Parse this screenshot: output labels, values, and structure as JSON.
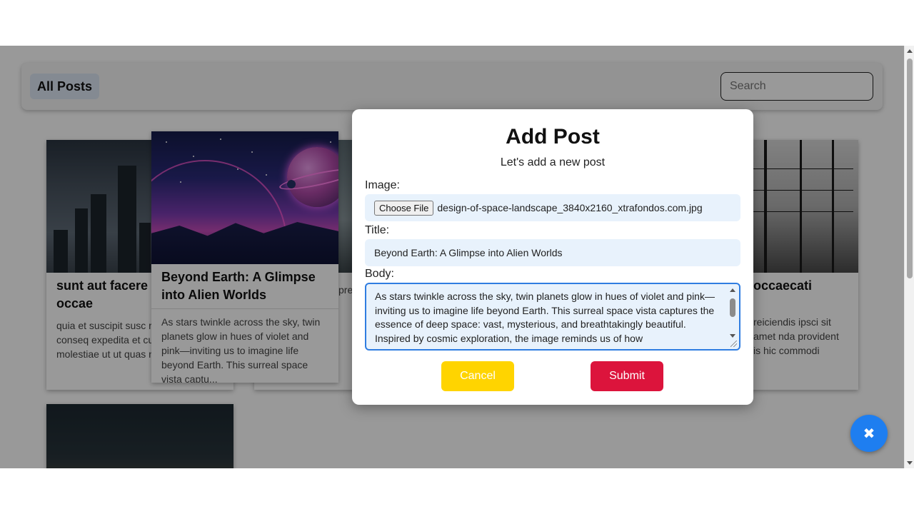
{
  "header": {
    "all_posts_label": "All Posts",
    "search_placeholder": "Search"
  },
  "cards": [
    {
      "title": "sunt aut facere provident occae",
      "body": "quia et suscipit susc recusandae conseq expedita et cum rep molestiae ut ut quas nostrum rerum..."
    },
    {
      "title": "Beyond Earth: A Glimpse into Alien Worlds",
      "body": "As stars twinkle across the sky, twin planets glow in hues of violet and pink—inviting us to imagine life beyond Earth. This surreal space vista captu..."
    },
    {
      "title": "",
      "body": "pre ugi v..."
    },
    {
      "title": "occaecati",
      "body": "reiciendis ipsci sit amet nda provident is hic commodi"
    }
  ],
  "modal": {
    "title": "Add Post",
    "subtitle": "Let's add a new post",
    "image_label": "Image:",
    "choose_file_label": "Choose File",
    "file_name": "design-of-space-landscape_3840x2160_xtrafondos.com.jpg",
    "title_label": "Title:",
    "title_value": "Beyond Earth: A Glimpse into Alien Worlds",
    "body_label": "Body:",
    "body_value": "As stars twinkle across the sky, twin planets glow in hues of violet and pink—inviting us to imagine life beyond Earth. This surreal space vista captures the essence of deep space: vast, mysterious, and breathtakingly beautiful. Inspired by cosmic exploration, the image reminds us of how",
    "cancel_label": "Cancel",
    "submit_label": "Submit"
  },
  "fab_icon": "✖",
  "colors": {
    "cancel": "#ffd400",
    "submit": "#dc143c",
    "fab": "#1e7ef0",
    "field_bg": "#e8f2fc"
  }
}
